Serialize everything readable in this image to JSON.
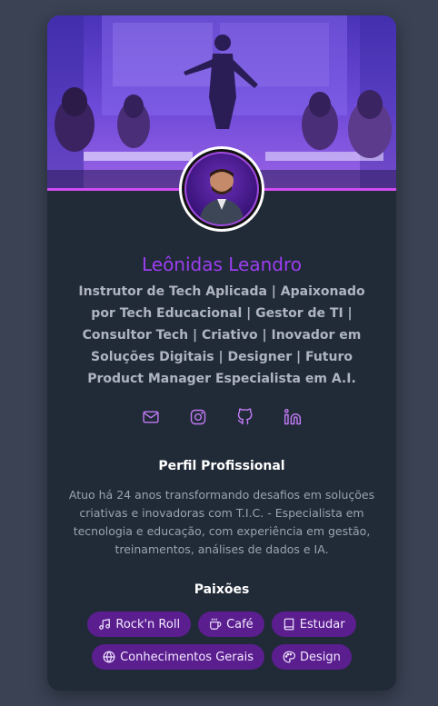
{
  "profile": {
    "name": "Leônidas Leandro",
    "bio": "Instrutor de Tech Aplicada | Apaixonado por Tech Educacional | Gestor de TI | Consultor Tech | Criativo | Inovador em Soluções Digitais | Designer | Futuro Product Manager Especialista em A.I."
  },
  "socials": [
    "mail-icon",
    "instagram-icon",
    "github-icon",
    "linkedin-icon"
  ],
  "professional": {
    "title": "Perfil Profissional",
    "text": "Atuo há 24 anos transformando desafios em soluções criativas e inovadoras com T.I.C. - Especialista em tecnologia e educação, com experiência em gestão, treinamentos, análises de dados e IA."
  },
  "passions": {
    "title": "Paixões",
    "tags": [
      {
        "label": "Rock'n Roll",
        "icon": "music-icon"
      },
      {
        "label": "Café",
        "icon": "coffee-icon"
      },
      {
        "label": "Estudar",
        "icon": "book-icon"
      },
      {
        "label": "Conhecimentos Gerais",
        "icon": "globe-icon"
      },
      {
        "label": "Design",
        "icon": "palette-icon"
      }
    ]
  },
  "colors": {
    "accent": "#9b3ef0",
    "card": "#212a37",
    "page": "#3a4253",
    "tag": "#5b1e8f"
  }
}
